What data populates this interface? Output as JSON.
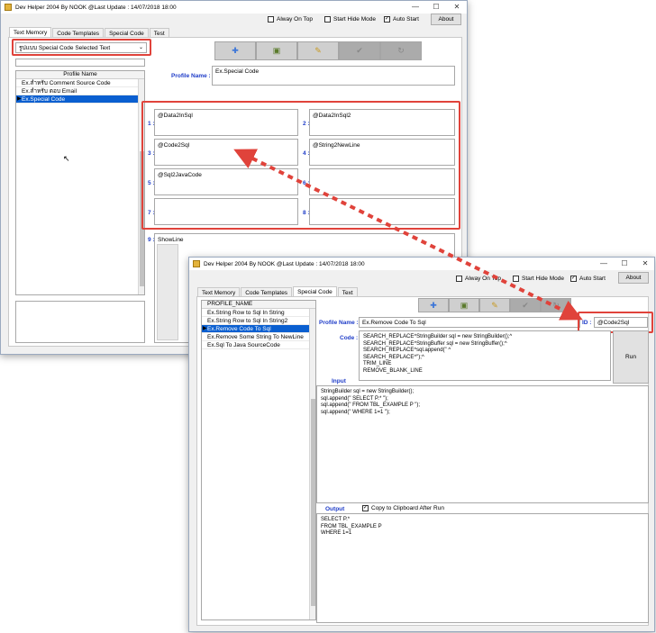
{
  "window1": {
    "title": "Dev Helper 2004 By NOOK  @Last Update : 14/07/2018 18:00",
    "always_on_top": "Alway On Top",
    "start_hide_mode": "Start Hide Mode",
    "auto_start": "Auto Start",
    "about": "About",
    "tabs": [
      "Text Memory",
      "Code Templates",
      "Special Code",
      "Test"
    ],
    "profile_dropdown": "รูปแบบ Special Code Selected Text",
    "grid_header": "Profile Name",
    "grid_rows": [
      "Ex.สำหรับ Comment Source Code",
      "Ex.สำหรับ ตอบ Email",
      "Ex.Special Code"
    ],
    "profile_name_label": "Profile Name :",
    "profile_name_value": "Ex.Special Code",
    "slots": [
      {
        "num": "1 :",
        "value": "@Data2InSql"
      },
      {
        "num": "2 :",
        "value": "@Data2InSql2"
      },
      {
        "num": "3 :",
        "value": "@Code2Sql"
      },
      {
        "num": "4 :",
        "value": "@String2NewLine"
      },
      {
        "num": "5 :",
        "value": "@Sql2JavaCode"
      },
      {
        "num": "6 :",
        "value": ""
      },
      {
        "num": "7 :",
        "value": ""
      },
      {
        "num": "8 :",
        "value": ""
      }
    ],
    "slot9_num": "9 :",
    "slot9_value": "ShowLine"
  },
  "window2": {
    "title": "Dev Helper 2004 By NOOK  @Last Update : 14/07/2018 18:00",
    "always_on_top": "Alway On Top",
    "start_hide_mode": "Start Hide Mode",
    "auto_start": "Auto Start",
    "about": "About",
    "tabs": [
      "Text Memory",
      "Code Templates",
      "Special Code",
      "Text"
    ],
    "grid_header": "PROFILE_NAME",
    "grid_rows": [
      "Ex.String Row to Sql In String",
      "Ex.String Row to Sql In String2",
      "Ex.Remove Code To Sql",
      "Ex.Remove Some String To NewLine",
      "Ex.Sql To Java SourceCode"
    ],
    "profile_name_label": "Profile Name :",
    "profile_name_value": "Ex.Remove Code To Sql",
    "id_label": "ID :",
    "id_value": "@Code2Sql",
    "code_label": "Code :",
    "code_value": "SEARCH_REPLACE^StringBuilder sql = new StringBuilder();^\nSEARCH_REPLACE^StringBuffer sql = new StringBuffer();^\nSEARCH_REPLACE^sql.append(\" ^\nSEARCH_REPLACE^\");^\nTRIM_LINE\nREMOVE_BLANK_LINE",
    "run": "Run",
    "input_label": "Input",
    "input_value": "StringBuilder sql = new StringBuilder();\nsql.append(\" SELECT P.* \");\nsql.append(\" FROM TBL_EXAMPLE P \");\nsql.append(\" WHERE 1=1 \");",
    "output_label": "Output",
    "copy_clipboard": "Copy to Clipboard After Run",
    "output_value": "SELECT P.*\nFROM TBL_EXAMPLE P\nWHERE 1=1"
  },
  "colors": {
    "accent_blue": "#1e3cc8",
    "highlight_red": "#e0433b",
    "selection": "#0a5fd0"
  },
  "icons": [
    "app-icon",
    "add-icon",
    "save-icon",
    "edit-icon",
    "check-icon",
    "redo-icon",
    "minimize-icon",
    "maximize-icon",
    "close-icon",
    "dropdown-arrow-icon",
    "row-pointer-icon",
    "cursor-icon"
  ]
}
